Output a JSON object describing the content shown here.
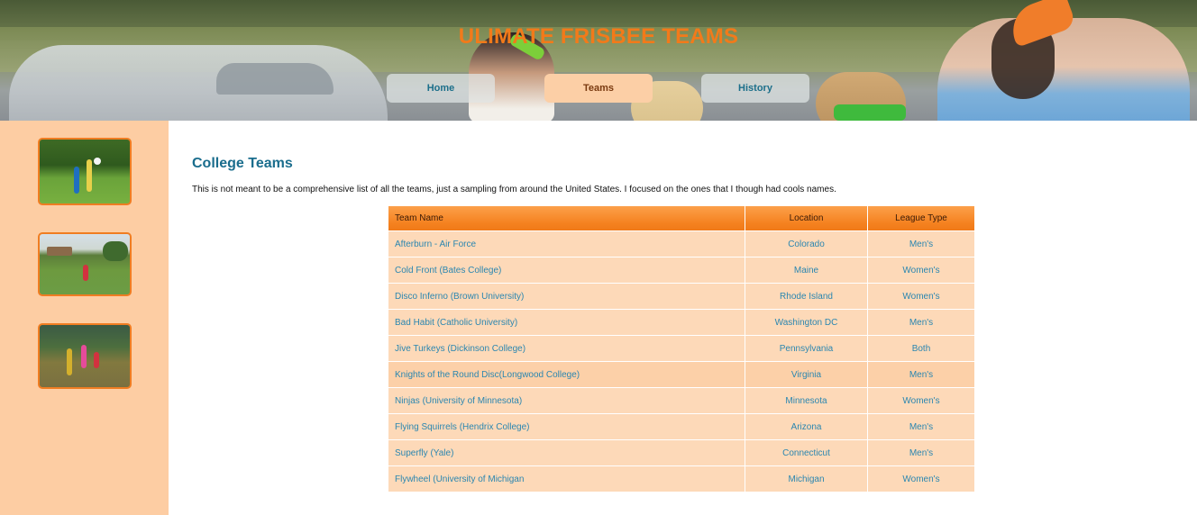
{
  "site": {
    "title": "ULIMATE FRISBEE TEAMS"
  },
  "nav": [
    {
      "label": "Home"
    },
    {
      "label": "Teams"
    },
    {
      "label": "History"
    }
  ],
  "sidebar": {
    "thumbnails": [
      "ultimate-photo-1",
      "ultimate-photo-2",
      "ultimate-photo-3"
    ]
  },
  "main": {
    "title": "College Teams",
    "intro": "This is not meant to be a comprehensive list of all the teams, just a sampling from around the United States. I focused on the ones that I though had cools names.",
    "table": {
      "headers": [
        "Team Name",
        "Location",
        "League Type"
      ],
      "rows": [
        [
          "Afterburn - Air Force",
          "Colorado",
          "Men's"
        ],
        [
          "Cold Front (Bates College)",
          "Maine",
          "Women's"
        ],
        [
          "Disco Inferno (Brown University)",
          "Rhode Island",
          "Women's"
        ],
        [
          "Bad Habit (Catholic University)",
          "Washington DC",
          "Men's"
        ],
        [
          "Jive Turkeys (Dickinson College)",
          "Pennsylvania",
          "Both"
        ],
        [
          "Knights of the Round Disc(Longwood College)",
          "Virginia",
          "Men's"
        ],
        [
          "Ninjas (University of Minnesota)",
          "Minnesota",
          "Women's"
        ],
        [
          "Flying Squirrels (Hendrix College)",
          "Arizona",
          "Men's"
        ],
        [
          "Superfly (Yale)",
          "Connecticut",
          "Men's"
        ],
        [
          "Flywheel (University of Michigan",
          "Michigan",
          "Women's"
        ]
      ]
    }
  },
  "colors": {
    "accent": "#f27a1a",
    "link": "#2a86b0",
    "sidebar": "#fdcda3",
    "table_row": "#fdd9b8"
  }
}
